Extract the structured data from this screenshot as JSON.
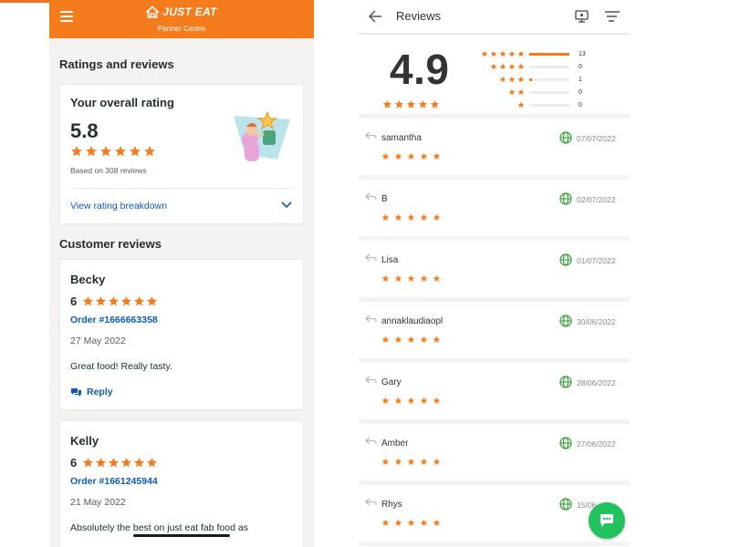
{
  "colors": {
    "brand_orange": "#f47c1c",
    "link_blue": "#0c5bb5",
    "star": "#f47c1c",
    "whatsapp_green": "#22c35e"
  },
  "left": {
    "header": {
      "brand": "JUST EAT",
      "subtitle": "Partner Centre"
    },
    "ratings_title": "Ratings and reviews",
    "overall": {
      "title": "Your overall rating",
      "score": "5.8",
      "stars": 6,
      "based_on": "Based on 308 reviews",
      "breakdown_link": "View rating breakdown"
    },
    "customer_reviews_title": "Customer reviews",
    "reviews": [
      {
        "name": "Becky",
        "score": "6",
        "stars": 6,
        "order": "Order #1666663358",
        "date": "27 May 2022",
        "comment": "Great food! Really tasty.",
        "reply": "Reply"
      },
      {
        "name": "Kelly",
        "score": "6",
        "stars": 6,
        "order": "Order #1661245944",
        "date": "21 May 2022",
        "comment": "Absolutely the best on just eat fab food as"
      }
    ]
  },
  "right": {
    "title": "Reviews",
    "score": "4.9",
    "stars": 5,
    "distribution": [
      {
        "stars": 5,
        "count": "13",
        "fraction": 1.0
      },
      {
        "stars": 4,
        "count": "0",
        "fraction": 0
      },
      {
        "stars": 3,
        "count": "1",
        "fraction": 0.077
      },
      {
        "stars": 2,
        "count": "0",
        "fraction": 0
      },
      {
        "stars": 1,
        "count": "0",
        "fraction": 0
      }
    ],
    "reviews": [
      {
        "name": "samantha",
        "date": "07/07/2022",
        "stars": 5
      },
      {
        "name": "B",
        "date": "02/07/2022",
        "stars": 5
      },
      {
        "name": "Lisa",
        "date": "01/07/2022",
        "stars": 5
      },
      {
        "name": "annaklaudiaopl",
        "date": "30/06/2022",
        "stars": 5
      },
      {
        "name": "Gary",
        "date": "28/06/2022",
        "stars": 5
      },
      {
        "name": "Amber",
        "date": "27/06/2022",
        "stars": 5
      },
      {
        "name": "Rhys",
        "date": "15/06",
        "stars": 5
      }
    ]
  }
}
